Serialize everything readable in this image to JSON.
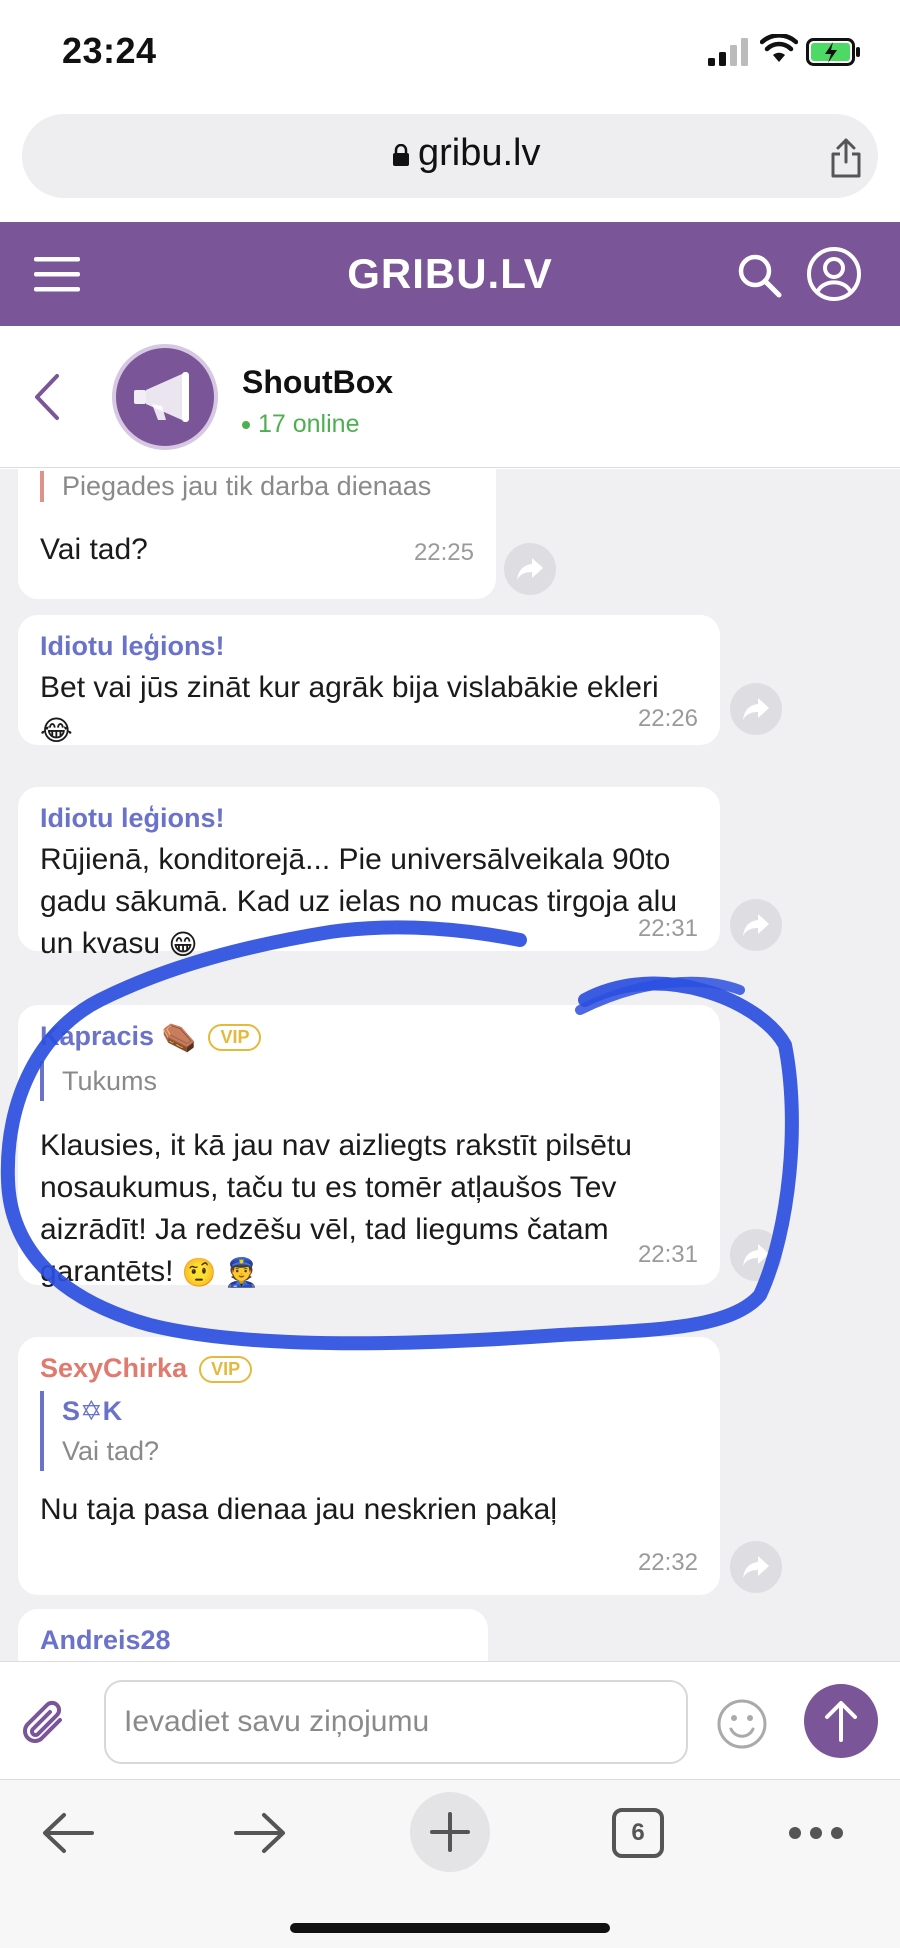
{
  "status_bar": {
    "time": "23:24"
  },
  "url_bar": {
    "url": "gribu.lv"
  },
  "site_header": {
    "logo": "GRIBU.LV"
  },
  "chat_header": {
    "title": "ShoutBox",
    "online": "17 online"
  },
  "messages": [
    {
      "quote_text": "Piegades jau tik darba dienaas",
      "text": "Vai tad?",
      "time": "22:25"
    },
    {
      "author": "Idiotu leģions!",
      "text": "Bet vai jūs zināt kur agrāk bija vislabākie ekleri",
      "emoji": "😂",
      "time": "22:26"
    },
    {
      "author": "Idiotu leģions!",
      "text": "Rūjienā, konditorejā... Pie universālveikala 90to gadu sākumā. Kad uz ielas no mucas tirgoja alu un kvasu",
      "emoji": "😁",
      "time": "22:31"
    },
    {
      "author": "Kapracis",
      "author_emoji": "⚰️",
      "badge": "VIP",
      "quote_text": "Tukums",
      "text": "Klausies, it kā jau nav aizliegts rakstīt pilsētu nosaukumus, taču tu es tomēr atļaušos Tev aizrādīt! Ja redzēšu vēl, tad liegums čatam garantēts!",
      "emoji": "🤨 👮",
      "time": "22:31"
    },
    {
      "author": "SexyChirka",
      "badge": "VIP",
      "quote_author": "S✡K",
      "quote_text": "Vai tad?",
      "text": "Nu taja pasa dienaa jau neskrien pakaļ",
      "time": "22:32"
    },
    {
      "author": "Andreis28"
    }
  ],
  "composer": {
    "placeholder": "Ievadiet savu ziņojumu"
  },
  "browser_toolbar": {
    "tab_count": "6"
  },
  "colors": {
    "brand": "#7a5597",
    "author": "#6a73c9",
    "author_vip": "#e07a6e",
    "vip_badge": "#e4b93c",
    "online": "#4caf50",
    "scribble": "#2b4fe0"
  }
}
